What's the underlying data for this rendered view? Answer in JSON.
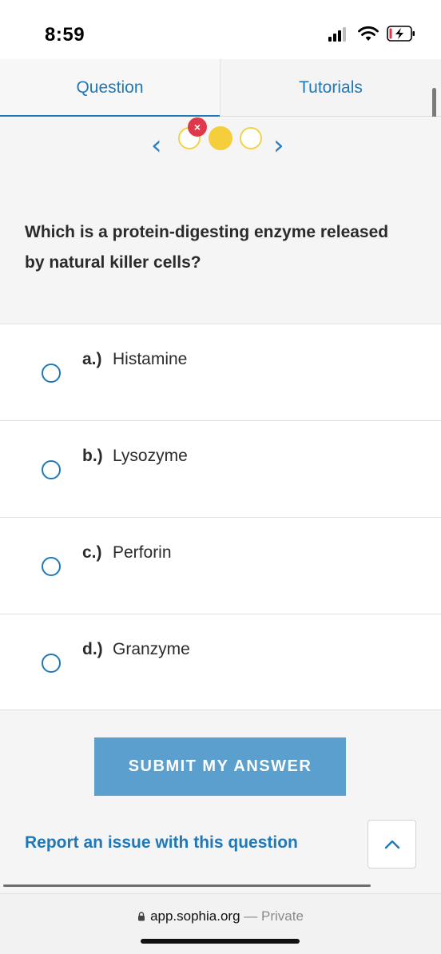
{
  "status_bar": {
    "time": "8:59"
  },
  "tabs": [
    {
      "label": "Question",
      "active": true
    },
    {
      "label": "Tutorials",
      "active": false
    }
  ],
  "progress": {
    "prev_symbol": "‹",
    "next_symbol": "›",
    "incorrect_mark": "×",
    "dots": [
      "incorrect",
      "current",
      "unanswered"
    ]
  },
  "question": {
    "text": "Which is a protein-digesting enzyme released by natural killer cells?"
  },
  "options": [
    {
      "letter": "a.)",
      "text": "Histamine"
    },
    {
      "letter": "b.)",
      "text": "Lysozyme"
    },
    {
      "letter": "c.)",
      "text": "Perforin"
    },
    {
      "letter": "d.)",
      "text": "Granzyme"
    }
  ],
  "actions": {
    "submit_label": "SUBMIT MY ANSWER",
    "report_label": "Report an issue with this question"
  },
  "browser": {
    "url": "app.sophia.org",
    "separator": " — ",
    "privacy": "Private"
  },
  "colors": {
    "accent": "#1f79b8",
    "submit_bg": "#5b9fcf",
    "dot_yellow": "#f5cf3b",
    "incorrect_red": "#e0384b"
  }
}
